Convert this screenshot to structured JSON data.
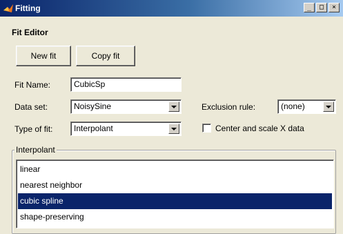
{
  "window": {
    "title": "Fitting",
    "controls": {
      "minimize": "_",
      "maximize": "□",
      "close": "×"
    }
  },
  "editor": {
    "heading": "Fit Editor"
  },
  "buttons": {
    "new_fit": "New fit",
    "copy_fit": "Copy fit"
  },
  "form": {
    "fit_name_label": "Fit Name:",
    "fit_name_value": "CubicSp",
    "data_set_label": "Data set:",
    "data_set_value": "NoisySine",
    "type_label": "Type of fit:",
    "type_value": "Interpolant",
    "exclusion_label": "Exclusion rule:",
    "exclusion_value": "(none)",
    "center_scale_label": "Center and scale X data",
    "center_scale_checked": false
  },
  "interpolant": {
    "group_label": "Interpolant",
    "items": [
      "linear",
      "nearest neighbor",
      "cubic spline",
      "shape-preserving"
    ],
    "selected": "cubic spline"
  },
  "colors": {
    "titlebar": "#0a246a",
    "selection": "#0a246a",
    "face": "#ece9d8"
  }
}
